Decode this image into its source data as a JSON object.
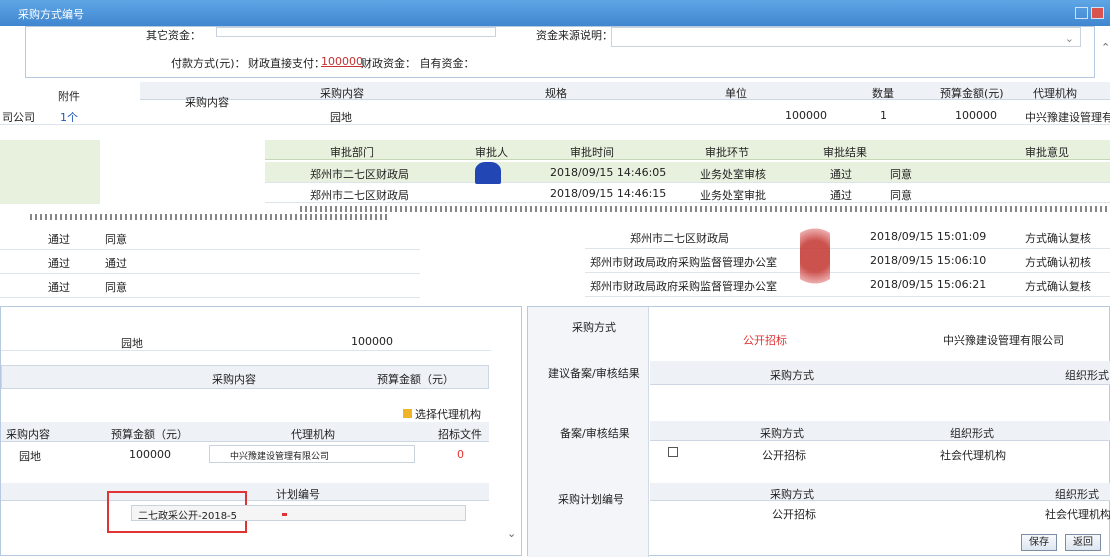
{
  "window": {
    "title": "采购方式编号"
  },
  "top_form": {
    "other_funds_label": "其它资金：",
    "fund_source_label": "资金来源说明：",
    "payment_label": "付款方式(元)：",
    "payment_text_pre": "财政直接支付：",
    "payment_amount": "100000",
    "payment_text_post": "财政资金：  自有资金："
  },
  "item_table": {
    "headers": [
      "附件",
      "采购内容",
      "采购内容",
      "规格",
      "单位",
      "数量",
      "预算金额(元)",
      "代理机构"
    ],
    "row": {
      "left": "司公司",
      "attach": "1个",
      "content": "园地",
      "amount1": "100000",
      "qty": "1",
      "budget": "100000",
      "agency": "中兴豫建设管理有限"
    }
  },
  "approval_table": {
    "headers": [
      "审批部门",
      "审批人",
      "审批时间",
      "审批环节",
      "审批结果",
      "审批意见"
    ],
    "rows": [
      {
        "dept": "郑州市二七区财政局",
        "time": "2018/09/15 14:46:05",
        "step": "业务处室审核",
        "result": "通过",
        "opinion": "同意"
      },
      {
        "dept": "郑州市二七区财政局",
        "time": "2018/09/15 14:46:15",
        "step": "业务处室审批",
        "result": "通过",
        "opinion": "同意"
      }
    ]
  },
  "approval_left": [
    {
      "result": "通过",
      "opinion": "同意"
    },
    {
      "result": "通过",
      "opinion": "通过"
    },
    {
      "result": "通过",
      "opinion": "同意"
    }
  ],
  "approval_right": [
    {
      "dept": "郑州市二七区财政局",
      "time": "2018/09/15 15:01:09",
      "step": "方式确认复核"
    },
    {
      "dept": "郑州市财政局政府采购监督管理办公室",
      "time": "2018/09/15 15:06:10",
      "step": "方式确认初核"
    },
    {
      "dept": "郑州市财政局政府采购监督管理办公室",
      "time": "2018/09/15 15:06:21",
      "step": "方式确认复核"
    }
  ],
  "left_lower": {
    "hdr_content": "采购内容",
    "hdr_budget": "预算金额（元）",
    "row_content": "园地",
    "row_budget": "100000",
    "section_content": "采购内容",
    "section_budget": "预算金额（元）",
    "choose_agency": "选择代理机构",
    "table_headers": [
      "采购内容",
      "预算金额（元）",
      "代理机构",
      "招标文件"
    ],
    "table_row": {
      "content": "园地",
      "budget": "100000",
      "agency": "中兴豫建设管理有限公司",
      "file": "0"
    },
    "plan_header": "计划编号",
    "plan_number": "二七政采公开-2018-5"
  },
  "right_lower": {
    "label_method": "采购方式",
    "method_value": "公开招标",
    "agency_value": "中兴豫建设管理有限公司",
    "label_suggest": "建议备案/审核结果",
    "suggest_headers": [
      "采购方式",
      "组织形式"
    ],
    "label_filing": "备案/审核结果",
    "filing_headers": [
      "采购方式",
      "组织形式"
    ],
    "filing_row": {
      "method": "公开招标",
      "form": "社会代理机构"
    },
    "label_plan": "采购计划编号",
    "plan_headers": [
      "采购方式",
      "组织形式"
    ],
    "plan_row": {
      "method": "公开招标",
      "form": "社会代理机构"
    }
  },
  "buttons": {
    "save": "保存",
    "back": "返回"
  }
}
